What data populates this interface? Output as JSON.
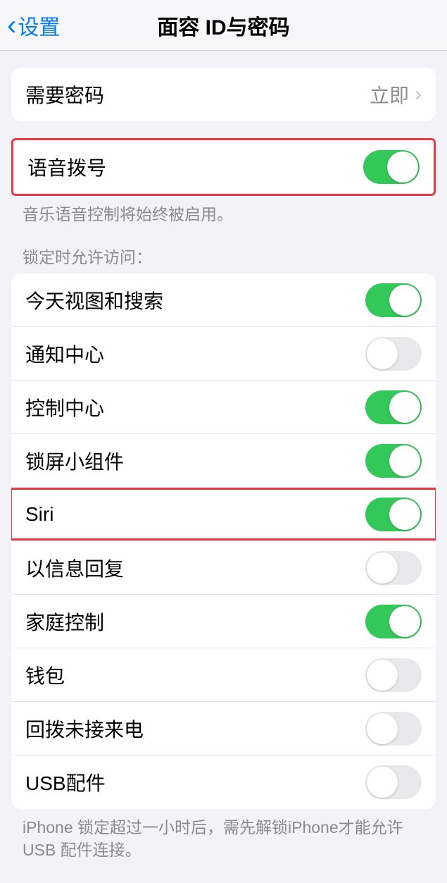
{
  "header": {
    "back_label": "设置",
    "title": "面容 ID与密码"
  },
  "require_passcode": {
    "label": "需要密码",
    "value": "立即"
  },
  "voice_dial": {
    "label": "语音拨号",
    "enabled": true,
    "footer": "音乐语音控制将始终被启用。"
  },
  "allow_section_header": "锁定时允许访问：",
  "allow_items": [
    {
      "label": "今天视图和搜索",
      "enabled": true,
      "highlighted": false
    },
    {
      "label": "通知中心",
      "enabled": false,
      "highlighted": false
    },
    {
      "label": "控制中心",
      "enabled": true,
      "highlighted": false
    },
    {
      "label": "锁屏小组件",
      "enabled": true,
      "highlighted": false
    },
    {
      "label": "Siri",
      "enabled": true,
      "highlighted": true
    },
    {
      "label": "以信息回复",
      "enabled": false,
      "highlighted": false
    },
    {
      "label": "家庭控制",
      "enabled": true,
      "highlighted": false
    },
    {
      "label": "钱包",
      "enabled": false,
      "highlighted": false
    },
    {
      "label": "回拨未接来电",
      "enabled": false,
      "highlighted": false
    },
    {
      "label": "USB配件",
      "enabled": false,
      "highlighted": false
    }
  ],
  "allow_footer": "iPhone 锁定超过一小时后，需先解锁iPhone才能允许USB 配件连接。"
}
